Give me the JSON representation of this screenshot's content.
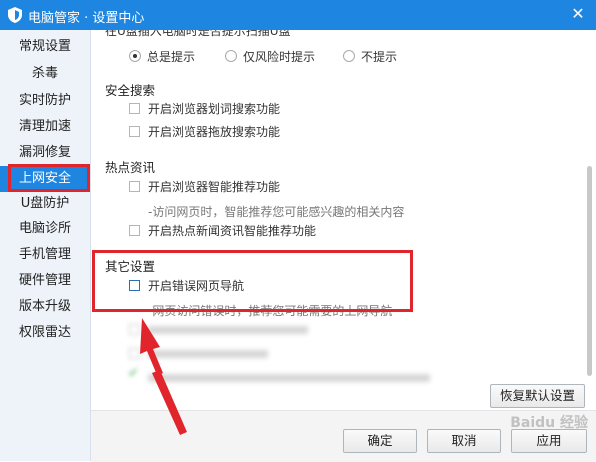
{
  "window": {
    "title": "电脑管家 · 设置中心",
    "close_icon": "close-icon",
    "title_color": "#1e86e0"
  },
  "sidebar": {
    "items": [
      {
        "label": "常规设置"
      },
      {
        "label": "杀毒"
      },
      {
        "label": "实时防护"
      },
      {
        "label": "清理加速"
      },
      {
        "label": "漏洞修复"
      },
      {
        "label": "上网安全",
        "active": true
      },
      {
        "label": "U盘防护"
      },
      {
        "label": "电脑诊所"
      },
      {
        "label": "手机管理"
      },
      {
        "label": "硬件管理"
      },
      {
        "label": "版本升级"
      },
      {
        "label": "权限雷达"
      }
    ]
  },
  "top_partial": {
    "question": "在U盘插入电脑时是否提示扫描U盘",
    "radios": [
      {
        "label": "总是提示",
        "selected": true
      },
      {
        "label": "仅风险时提示",
        "selected": false
      },
      {
        "label": "不提示",
        "selected": false
      }
    ]
  },
  "safe_search": {
    "title": "安全搜索",
    "options": [
      {
        "label": "开启浏览器划词搜索功能",
        "checked": false
      },
      {
        "label": "开启浏览器拖放搜索功能",
        "checked": false
      }
    ]
  },
  "hot_news": {
    "title": "热点资讯",
    "option1": {
      "label": "开启浏览器智能推荐功能",
      "checked": false
    },
    "option1_hint": "-访问网页时，智能推荐您可能感兴趣的相关内容",
    "option2": {
      "label": "开启热点新闻资讯智能推荐功能",
      "checked": false
    }
  },
  "other": {
    "title": "其它设置",
    "option1": {
      "label": "开启错误网页导航",
      "checked": false
    },
    "option1_hint": "-网页访问错误时，推荐您可能需要的上网导航"
  },
  "buttons": {
    "restore_defaults": "恢复默认设置",
    "ok": "确定",
    "cancel": "取消",
    "apply": "应用"
  },
  "watermark": "Baidu 经验",
  "accent_colors": {
    "highlight_red": "#e0262c",
    "brand_blue": "#1e86e0"
  }
}
